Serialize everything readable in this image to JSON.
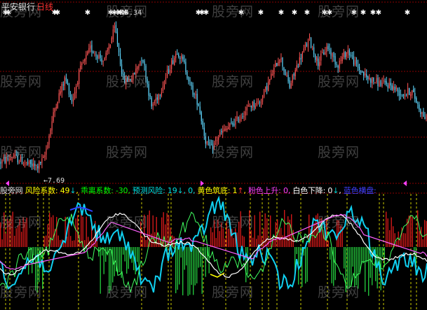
{
  "title": {
    "stock": "平安银行",
    "period": "日线"
  },
  "watermark": "股旁网",
  "chart_data": [
    {
      "type": "candlestick",
      "high_label": "15.34",
      "low_label": "7.69",
      "ylim": [
        7.0,
        16.3
      ],
      "n": 300,
      "anchors": [
        [
          0,
          8.0
        ],
        [
          18,
          8.3
        ],
        [
          38,
          7.9
        ],
        [
          52,
          7.75
        ],
        [
          62,
          8.2
        ],
        [
          78,
          11.1
        ],
        [
          92,
          12.6
        ],
        [
          102,
          11.3
        ],
        [
          112,
          12.9
        ],
        [
          128,
          14.2
        ],
        [
          148,
          13.5
        ],
        [
          163,
          15.34
        ],
        [
          175,
          12.4
        ],
        [
          188,
          12.6
        ],
        [
          202,
          13.8
        ],
        [
          215,
          11.0
        ],
        [
          228,
          11.9
        ],
        [
          240,
          13.1
        ],
        [
          252,
          14.1
        ],
        [
          262,
          13.3
        ],
        [
          272,
          12.0
        ],
        [
          282,
          11.2
        ],
        [
          292,
          9.2
        ],
        [
          300,
          8.7
        ],
        [
          312,
          9.5
        ],
        [
          325,
          9.9
        ],
        [
          340,
          10.4
        ],
        [
          356,
          11.1
        ],
        [
          370,
          11.3
        ],
        [
          385,
          12.6
        ],
        [
          398,
          13.8
        ],
        [
          412,
          12.1
        ],
        [
          424,
          13.4
        ],
        [
          440,
          14.7
        ],
        [
          452,
          13.4
        ],
        [
          466,
          14.3
        ],
        [
          480,
          13.3
        ],
        [
          495,
          14.1
        ],
        [
          508,
          13.2
        ],
        [
          522,
          12.6
        ],
        [
          540,
          12.3
        ],
        [
          556,
          12.2
        ],
        [
          572,
          11.7
        ],
        [
          586,
          11.9
        ],
        [
          600,
          10.7
        ],
        [
          608,
          10.3
        ]
      ]
    },
    {
      "type": "indicator",
      "series": [
        {
          "name": "风险系数",
          "value": "49",
          "dir": "down"
        },
        {
          "name": "乖离系数",
          "value": "-30",
          "dir": ""
        },
        {
          "name": "预测风险",
          "value": "19",
          "dir": "down"
        },
        {
          "name": "",
          "value": "0",
          "dir": ""
        },
        {
          "name": "黄色筑底",
          "value": "1",
          "dir": "up"
        },
        {
          "name": "粉色上升",
          "value": "0",
          "dir": ""
        },
        {
          "name": "白色下降",
          "value": "0",
          "dir": "down"
        },
        {
          "name": "蓝色横盘",
          "value": "",
          "dir": ""
        }
      ],
      "label_prefix": "股旁网"
    }
  ],
  "colors": {
    "background": "#000000",
    "up": "#ff5555",
    "down": "#5fd8ff",
    "grid": "#8b0000",
    "positive_bar": "#d01818",
    "negative_bar": "#22c03a",
    "cyan_line": "#10d0f0",
    "green_line": "#40ff60",
    "white_line": "#ffffff",
    "pink_line": "#ff60ff",
    "blue_line": "#3040ff",
    "yellow_line": "#ffff00",
    "risk": "#ffff00",
    "bias": "#00ff00",
    "predict": "#00e0e0",
    "yellow_bottom": "#ffff00",
    "pink_rise": "#ff40ff",
    "white_fall": "#ffffff",
    "blue_flat": "#4040ff"
  }
}
